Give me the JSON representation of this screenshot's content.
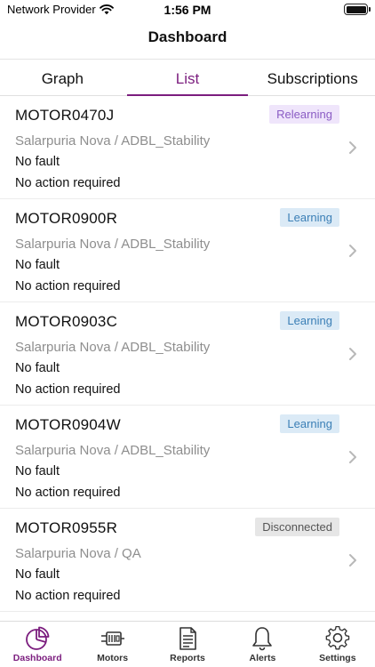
{
  "status_bar": {
    "carrier": "Network Provider",
    "time": "1:56 PM",
    "battery_level": 1.0
  },
  "nav": {
    "title": "Dashboard"
  },
  "tabs": [
    {
      "label": "Graph",
      "active": false
    },
    {
      "label": "List",
      "active": true
    },
    {
      "label": "Subscriptions",
      "active": false
    }
  ],
  "motors": [
    {
      "name": "MOTOR0470J",
      "location": "Salarpuria Nova / ADBL_Stability",
      "fault": "No fault",
      "action": "No action required",
      "status": "Relearning",
      "status_kind": "relearning"
    },
    {
      "name": "MOTOR0900R",
      "location": "Salarpuria Nova / ADBL_Stability",
      "fault": "No fault",
      "action": "No action required",
      "status": "Learning",
      "status_kind": "learning"
    },
    {
      "name": "MOTOR0903C",
      "location": "Salarpuria Nova / ADBL_Stability",
      "fault": "No fault",
      "action": "No action required",
      "status": "Learning",
      "status_kind": "learning"
    },
    {
      "name": "MOTOR0904W",
      "location": "Salarpuria Nova / ADBL_Stability",
      "fault": "No fault",
      "action": "No action required",
      "status": "Learning",
      "status_kind": "learning"
    },
    {
      "name": "MOTOR0955R",
      "location": "Salarpuria Nova / QA",
      "fault": "No fault",
      "action": "No action required",
      "status": "Disconnected",
      "status_kind": "disconnected"
    }
  ],
  "tabbar": [
    {
      "label": "Dashboard",
      "icon": "pie-chart-icon",
      "active": true
    },
    {
      "label": "Motors",
      "icon": "motor-icon",
      "active": false
    },
    {
      "label": "Reports",
      "icon": "document-icon",
      "active": false
    },
    {
      "label": "Alerts",
      "icon": "bell-icon",
      "active": false
    },
    {
      "label": "Settings",
      "icon": "gear-icon",
      "active": false
    }
  ],
  "colors": {
    "accent": "#7b1d7e",
    "relearning_bg": "#efe5fb",
    "relearning_text": "#8a5cc4",
    "learning_bg": "#dbeaf6",
    "learning_text": "#3b7fb6",
    "disconnected_bg": "#e6e6e6",
    "disconnected_text": "#555555"
  }
}
